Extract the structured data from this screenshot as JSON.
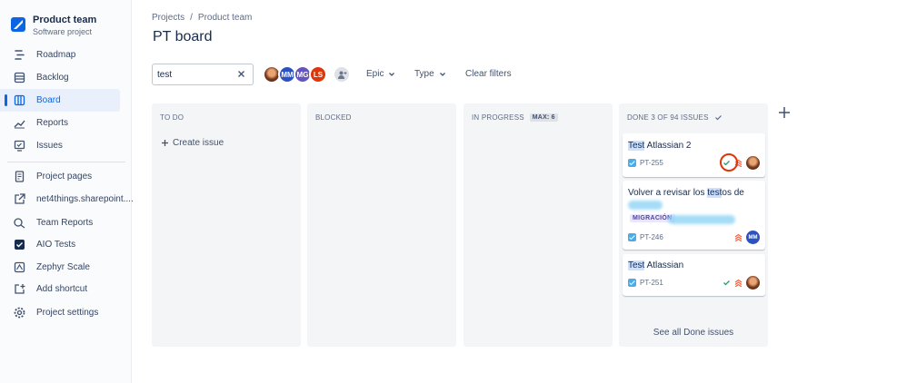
{
  "project": {
    "name": "Product team",
    "type": "Software project"
  },
  "sidebar": {
    "items": [
      {
        "label": "Roadmap",
        "icon": "roadmap-icon"
      },
      {
        "label": "Backlog",
        "icon": "backlog-icon"
      },
      {
        "label": "Board",
        "icon": "board-icon",
        "active": true
      },
      {
        "label": "Reports",
        "icon": "reports-icon"
      },
      {
        "label": "Issues",
        "icon": "issues-icon"
      },
      {
        "label": "Project pages",
        "icon": "pages-icon"
      },
      {
        "label": "net4things.sharepoint....",
        "icon": "external-link-icon"
      },
      {
        "label": "Team Reports",
        "icon": "team-reports-icon"
      },
      {
        "label": "AIO Tests",
        "icon": "aio-tests-icon"
      },
      {
        "label": "Zephyr Scale",
        "icon": "zephyr-scale-icon"
      },
      {
        "label": "Add shortcut",
        "icon": "add-shortcut-icon"
      },
      {
        "label": "Project settings",
        "icon": "gear-icon"
      }
    ]
  },
  "breadcrumbs": [
    "Projects",
    "/",
    "Product team"
  ],
  "page_title": "PT board",
  "toolbar": {
    "search_value": "test",
    "avatars": [
      "MM",
      "MG",
      "LS"
    ],
    "epic_label": "Epic",
    "type_label": "Type",
    "clear_label": "Clear filters"
  },
  "columns": {
    "todo": {
      "title": "TO DO",
      "create_label": "Create issue"
    },
    "blocked": {
      "title": "BLOCKED"
    },
    "in_progress": {
      "title": "IN PROGRESS",
      "max": "MAX: 6"
    },
    "done": {
      "title": "DONE 3 OF 94 ISSUES",
      "see_all": "See all Done issues",
      "cards": [
        {
          "title_hl": "Test",
          "title_rest": " Atlassian 2",
          "key": "PT-255"
        },
        {
          "title_pre": "Volver a revisar los ",
          "title_hl": "test",
          "title_rest": "os de",
          "lozenge": "MIGRACIÓN",
          "key": "PT-246",
          "assignee": "MM"
        },
        {
          "title_hl": "Test",
          "title_rest": " Atlassian",
          "key": "PT-251"
        }
      ]
    }
  },
  "colors": {
    "accent": "#0c66e4",
    "priority": "#ff5630",
    "done": "#22a06b"
  }
}
